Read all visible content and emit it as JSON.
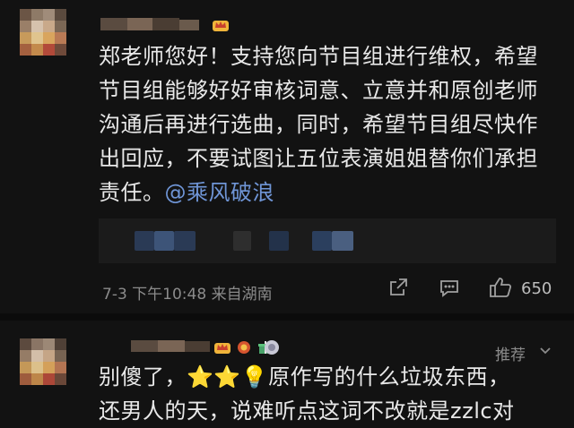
{
  "comment1": {
    "lines": [
      "郑老师您好！支持您向节目组进行维权，希望",
      "节目组能够好好审核词意、立意并和原创老师",
      "沟通后再进行选曲，同时，希望节目组尽快作",
      "出回应，不要试图让五位表演姐姐替你们承担"
    ],
    "line5_prefix": "责任。",
    "mention": "@乘风破浪",
    "meta": "7-3  下午10:48  来自湖南",
    "like_count": "650"
  },
  "comment2": {
    "recommend": "推荐",
    "line1_prefix": "别傻了，",
    "emojis": "⭐⭐💡",
    "line1_suffix": "原作写的什么垃圾东西，",
    "line2": "还男人的天，说难听点这词不改就是zzlc对"
  },
  "colors": {
    "background": "#121212",
    "text": "#e8e8e8",
    "mention": "#6f95d6",
    "meta": "#8b8b8b"
  }
}
